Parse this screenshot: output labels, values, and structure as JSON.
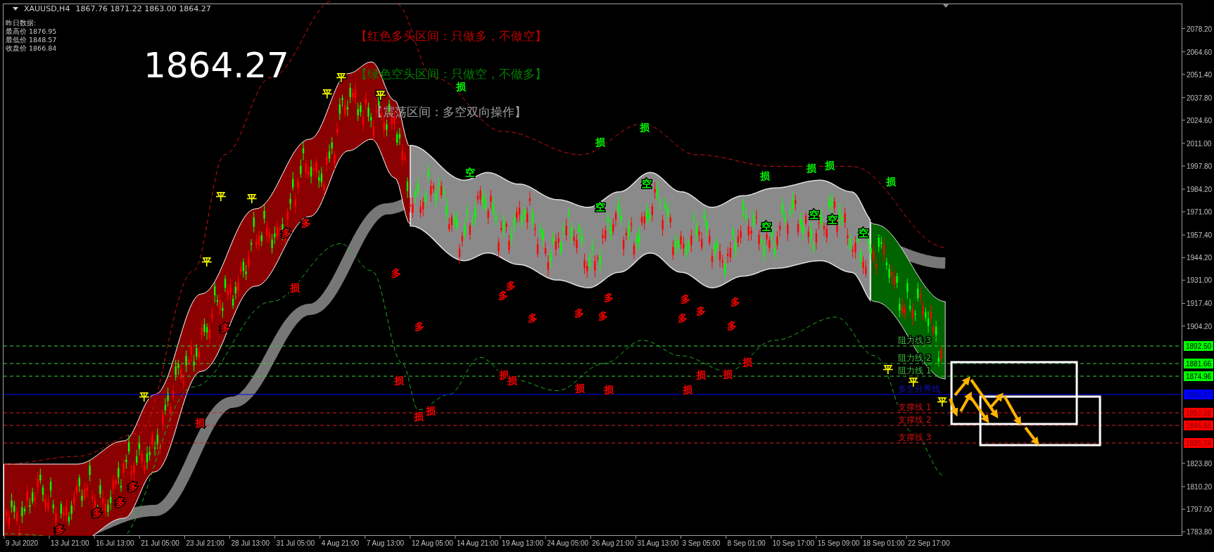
{
  "header": {
    "symbol": "XAUUSD,H4",
    "ohlc": "1867.76 1871.22 1863.00 1864.27"
  },
  "info": {
    "title": "昨日数据:",
    "lines": [
      "最高价 1876.95",
      "最低价 1848.57",
      "收盘价 1866.84"
    ]
  },
  "big_price": "1864.27",
  "legends": [
    {
      "text": "【红色多头区间：只做多，不做空】",
      "color": "#c00000"
    },
    {
      "text": "【绿色空头区间：只做空，不做多】",
      "color": "#008000"
    },
    {
      "text": "【震荡区间：多空双向操作】",
      "color": "#a0a0a0"
    }
  ],
  "markers": [
    {
      "text": "平",
      "color": "#ffff00"
    },
    {
      "text": "平",
      "color": "#ffff00"
    },
    {
      "text": "平",
      "color": "#ffff00"
    },
    {
      "text": "平",
      "color": "#ffff00"
    },
    {
      "text": "平",
      "color": "#ffff00"
    },
    {
      "text": "平",
      "color": "#ffff00"
    },
    {
      "text": "平",
      "color": "#ffff00"
    },
    {
      "text": "平",
      "color": "#ffff00"
    },
    {
      "text": "平",
      "color": "#ffff00"
    },
    {
      "text": "平",
      "color": "#ffff00"
    },
    {
      "text": "多",
      "color": "#ff0000"
    },
    {
      "text": "多",
      "color": "#ff0000"
    },
    {
      "text": "多",
      "color": "#ff0000"
    },
    {
      "text": "多",
      "color": "#ff0000"
    },
    {
      "text": "多",
      "color": "#ff0000"
    },
    {
      "text": "多",
      "color": "#ff0000"
    },
    {
      "text": "多",
      "color": "#ff0000"
    },
    {
      "text": "多",
      "color": "#ff0000"
    },
    {
      "text": "多",
      "color": "#ff0000"
    },
    {
      "text": "多",
      "color": "#ff0000"
    },
    {
      "text": "多",
      "color": "#ff0000"
    },
    {
      "text": "多",
      "color": "#ff0000"
    },
    {
      "text": "多",
      "color": "#ff0000"
    },
    {
      "text": "多",
      "color": "#ff0000"
    },
    {
      "text": "多",
      "color": "#ff0000"
    },
    {
      "text": "多",
      "color": "#ff0000"
    },
    {
      "text": "多",
      "color": "#ff0000"
    },
    {
      "text": "多",
      "color": "#ff0000"
    },
    {
      "text": "多",
      "color": "#ff0000"
    },
    {
      "text": "多",
      "color": "#ff0000"
    },
    {
      "text": "损",
      "color": "#ff0000"
    },
    {
      "text": "损",
      "color": "#ff0000"
    },
    {
      "text": "损",
      "color": "#ff0000"
    },
    {
      "text": "损",
      "color": "#ff0000"
    },
    {
      "text": "损",
      "color": "#ff0000"
    },
    {
      "text": "损",
      "color": "#ff0000"
    },
    {
      "text": "损",
      "color": "#ff0000"
    },
    {
      "text": "损",
      "color": "#ff0000"
    },
    {
      "text": "损",
      "color": "#ff0000"
    },
    {
      "text": "损",
      "color": "#ff0000"
    },
    {
      "text": "损",
      "color": "#ff0000"
    },
    {
      "text": "损",
      "color": "#ff0000"
    },
    {
      "text": "损",
      "color": "#ff0000"
    },
    {
      "text": "损",
      "color": "#00ff00"
    },
    {
      "text": "损",
      "color": "#00ff00"
    },
    {
      "text": "损",
      "color": "#00ff00"
    },
    {
      "text": "损",
      "color": "#00ff00"
    },
    {
      "text": "损",
      "color": "#00ff00"
    },
    {
      "text": "损",
      "color": "#00ff00"
    },
    {
      "text": "损",
      "color": "#00ff00"
    },
    {
      "text": "空",
      "color": "#00ff00"
    },
    {
      "text": "空",
      "color": "#00ff00"
    },
    {
      "text": "空",
      "color": "#00ff00"
    },
    {
      "text": "空",
      "color": "#00ff00"
    },
    {
      "text": "空",
      "color": "#00ff00"
    },
    {
      "text": "空",
      "color": "#00ff00"
    },
    {
      "text": "空",
      "color": "#00ff00"
    }
  ],
  "levels": [
    {
      "label": "阻力线 3",
      "kind": "resistance",
      "tag": "1892.50"
    },
    {
      "label": "阻力线 2",
      "kind": "resistance",
      "tag": "1881.66"
    },
    {
      "label": "阻力线 1",
      "kind": "resistance",
      "tag": "1874.96"
    },
    {
      "label": "多空分界线",
      "kind": "pivot",
      "tag": "1864.27"
    },
    {
      "label": "支撑线 1",
      "kind": "support",
      "tag": "1853.28"
    },
    {
      "label": "支撑线 2",
      "kind": "support",
      "tag": "1846.58"
    },
    {
      "label": "支撑线 3",
      "kind": "support",
      "tag": "1835.74"
    }
  ],
  "price_axis": {
    "labels": [
      "2078.20",
      "2064.60",
      "2051.40",
      "2037.80",
      "2024.60",
      "2011.00",
      "1997.80",
      "1984.20",
      "1971.00",
      "1957.40",
      "1944.20",
      "1931.00",
      "1917.40",
      "1904.20",
      "1823.80",
      "1810.20",
      "1797.00",
      "1783.80"
    ]
  },
  "time_axis": {
    "labels": [
      "9 Jul 2020",
      "13 Jul 21:00",
      "16 Jul 13:00",
      "21 Jul 05:00",
      "23 Jul 21:00",
      "28 Jul 13:00",
      "31 Jul 05:00",
      "4 Aug 21:00",
      "7 Aug 13:00",
      "12 Aug 05:00",
      "14 Aug 21:00",
      "19 Aug 13:00",
      "24 Aug 05:00",
      "26 Aug 21:00",
      "31 Aug 13:00",
      "3 Sep 05:00",
      "8 Sep 01:00",
      "10 Sep 17:00",
      "15 Sep 09:00",
      "18 Sep 01:00",
      "22 Sep 17:00"
    ]
  }
}
